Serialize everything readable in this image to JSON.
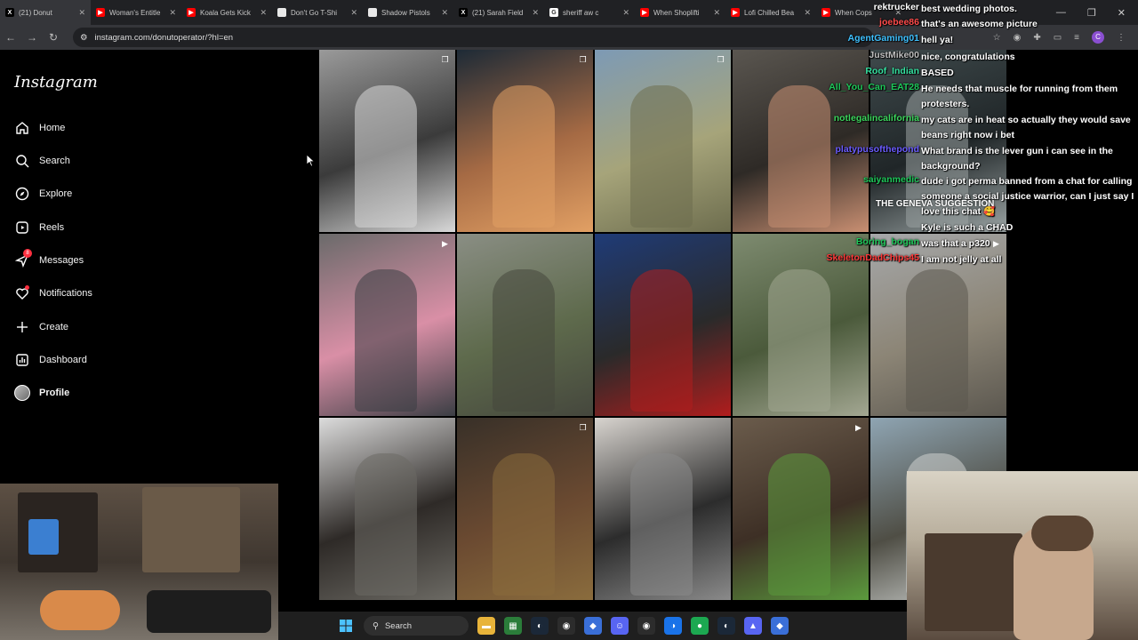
{
  "browser": {
    "tabs": [
      {
        "label": "(21) Donut",
        "color": "#000000",
        "glyph": "X"
      },
      {
        "label": "Woman's Entitle",
        "color": "#ff0000",
        "glyph": "▶"
      },
      {
        "label": "Koala Gets Kick",
        "color": "#ff0000",
        "glyph": "▶"
      },
      {
        "label": "Don't Go T-Shi",
        "color": "#e8e8e8",
        "glyph": ""
      },
      {
        "label": "Shadow Pistols",
        "color": "#e8e8e8",
        "glyph": ""
      },
      {
        "label": "(21) Sarah Field",
        "color": "#000000",
        "glyph": "X"
      },
      {
        "label": "sheriff aw c",
        "color": "#ffffff",
        "glyph": "G"
      },
      {
        "label": "When Shoplifti",
        "color": "#ff0000",
        "glyph": "▶"
      },
      {
        "label": "Lofi Chilled Bea",
        "color": "#ff0000",
        "glyph": "▶"
      },
      {
        "label": "When Cops",
        "color": "#ff0000",
        "glyph": "▶"
      }
    ],
    "url": "instagram.com/donutoperator/?hl=en"
  },
  "sidebar": {
    "logo": "Instagram",
    "messages_badge": "8",
    "items": [
      {
        "label": "Home",
        "icon": "home-icon",
        "glyph": "⌂"
      },
      {
        "label": "Search",
        "icon": "search-icon",
        "glyph": "⚲"
      },
      {
        "label": "Explore",
        "icon": "compass-icon",
        "glyph": "◎"
      },
      {
        "label": "Reels",
        "icon": "reels-icon",
        "glyph": "▣"
      },
      {
        "label": "Messages",
        "icon": "messenger-icon",
        "glyph": "✈"
      },
      {
        "label": "Notifications",
        "icon": "heart-icon",
        "glyph": "♡"
      },
      {
        "label": "Create",
        "icon": "plus-icon",
        "glyph": "+"
      },
      {
        "label": "Dashboard",
        "icon": "dashboard-icon",
        "glyph": "▤"
      },
      {
        "label": "Profile",
        "icon": "profile-avatar",
        "glyph": ""
      }
    ]
  },
  "grid": {
    "tiles": [
      {
        "icon": "carousel-icon",
        "colors": [
          "#9a9a9a",
          "#3b3b3b",
          "#d8d8d8"
        ]
      },
      {
        "icon": "carousel-icon",
        "colors": [
          "#1d2a36",
          "#a56a44",
          "#e2a064"
        ]
      },
      {
        "icon": "carousel-icon",
        "colors": [
          "#7d9ab5",
          "#a6a47a",
          "#6d6d4e"
        ]
      },
      {
        "icon": "",
        "colors": [
          "#5a5650",
          "#2e2a26",
          "#c98f72"
        ]
      },
      {
        "icon": "",
        "colors": [
          "#3f4a4c",
          "#202628",
          "#9aa3a3"
        ]
      },
      {
        "icon": "reel-icon",
        "colors": [
          "#6a6a6a",
          "#d98fa6",
          "#3b3e44"
        ]
      },
      {
        "icon": "",
        "colors": [
          "#8a8e84",
          "#5e6a4c",
          "#45473d"
        ]
      },
      {
        "icon": "",
        "colors": [
          "#1f3b77",
          "#2a2a2a",
          "#b01d1d"
        ]
      },
      {
        "icon": "",
        "colors": [
          "#7e8b70",
          "#4b5a3b",
          "#a3a792"
        ]
      },
      {
        "icon": "reel-icon",
        "colors": [
          "#a6a8aa",
          "#8c8576",
          "#5b574f"
        ]
      },
      {
        "icon": "",
        "colors": [
          "#dcdcdc",
          "#2e2a27",
          "#6c6a64"
        ]
      },
      {
        "icon": "carousel-icon",
        "colors": [
          "#383028",
          "#6b4a31",
          "#8a6c3d"
        ]
      },
      {
        "icon": "",
        "colors": [
          "#d8d4cf",
          "#2c2c2c",
          "#8a8a8a"
        ]
      },
      {
        "icon": "reel-icon",
        "colors": [
          "#6b5c4c",
          "#3d2f25",
          "#5b9a3d"
        ]
      },
      {
        "icon": "",
        "colors": [
          "#8fa5b3",
          "#4f4e45",
          "#cfd2d0"
        ]
      }
    ]
  },
  "chat": {
    "lines": [
      {
        "user": "rektrucker",
        "color": "#ffffff",
        "msg": "best wedding photos."
      },
      {
        "user": "joebee86",
        "color": "#ff4b4b",
        "msg": "that's an awesome picture"
      },
      {
        "user": "AgentGaming01",
        "color": "#3fc1ff",
        "msg": "hell ya!"
      },
      {
        "user": "JustMike00",
        "color": "#bdbdbd",
        "msg": "nice, congratulations"
      },
      {
        "user": "Roof_Indian",
        "color": "#35e0a0",
        "msg": "BASED"
      },
      {
        "user": "All_You_Can_EAT28",
        "color": "#1ec85a",
        "msg": "He needs that muscle for running from them protesters."
      },
      {
        "user": "notlegalincalifornia",
        "color": "#3cd65d",
        "msg": "my cats are in heat so actually they would save beans right now i bet"
      },
      {
        "user": "platypusofthepond",
        "color": "#6b5cff",
        "msg": "What brand is the lever gun i can see in the background?"
      },
      {
        "user": "saiyanmedic",
        "color": "#1ec85a",
        "msg": "dude i got perma banned from a chat for calling someone a social justice warrior, can I just say I love this chat 🥰"
      },
      {
        "user": "",
        "color": "#ffffff",
        "msg": "Kyle is such a CHAD"
      },
      {
        "user": "Boring_bogan",
        "color": "#1ec85a",
        "msg": "was that a p320"
      },
      {
        "user": "SkeletonDadChips45",
        "color": "#ff3a3a",
        "msg": "I am not jelly at all"
      }
    ],
    "overlay_text": "THE GENEVA SUGGESTION"
  },
  "taskbar": {
    "search_label": "Search"
  }
}
